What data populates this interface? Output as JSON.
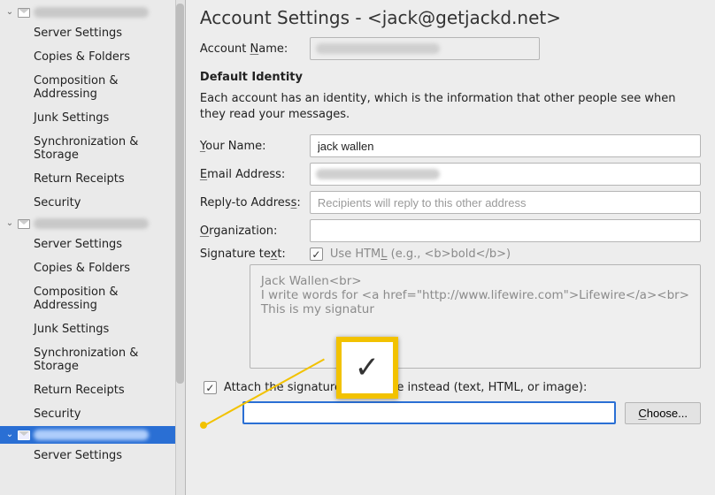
{
  "sidebar": {
    "accounts": [
      {
        "name": "[account 1]",
        "items": [
          {
            "label": "Server Settings"
          },
          {
            "label": "Copies & Folders"
          },
          {
            "label": "Composition & Addressing"
          },
          {
            "label": "Junk Settings"
          },
          {
            "label": "Synchronization & Storage"
          },
          {
            "label": "Return Receipts"
          },
          {
            "label": "Security"
          }
        ]
      },
      {
        "name": "[account 2]",
        "items": [
          {
            "label": "Server Settings"
          },
          {
            "label": "Copies & Folders"
          },
          {
            "label": "Composition & Addressing"
          },
          {
            "label": "Junk Settings"
          },
          {
            "label": "Synchronization & Storage"
          },
          {
            "label": "Return Receipts"
          },
          {
            "label": "Security"
          }
        ]
      },
      {
        "name": "[account 3]",
        "selected": true,
        "items": [
          {
            "label": "Server Settings"
          }
        ]
      }
    ]
  },
  "main": {
    "title": "Account Settings - <jack@getjackd.net>",
    "account_name_label": "Account Name:",
    "account_name_value": "",
    "default_identity_heading": "Default Identity",
    "identity_desc": "Each account has an identity, which is the information that other people see when they read your messages.",
    "your_name_label": "Your Name:",
    "your_name_value": "jack wallen",
    "email_label": "Email Address:",
    "email_value": "",
    "replyto_label": "Reply-to Address:",
    "replyto_placeholder": "Recipients will reply to this other address",
    "replyto_value": "",
    "org_label": "Organization:",
    "org_value": "",
    "sig_label": "Signature text:",
    "usehtml_label": "Use HTML (e.g., <b>bold</b>)",
    "sig_lines": [
      "Jack Wallen<br>",
      "I write words for <a href=\"http://www.lifewire.com\">Lifewire</a><br>",
      "This is my signatur"
    ],
    "attach_label": "Attach the signature from a file instead (text, HTML, or image):",
    "file_value": "",
    "choose_label": "Choose..."
  },
  "callout": {
    "symbol": "✓"
  }
}
